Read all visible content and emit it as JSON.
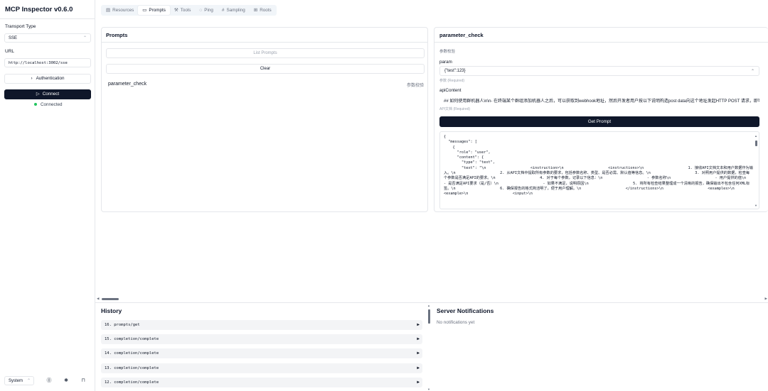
{
  "sidebar": {
    "title": "MCP Inspector v0.6.0",
    "transport_label": "Transport Type",
    "transport_value": "SSE",
    "url_label": "URL",
    "url_value": "http://localhost:3002/sse",
    "auth_label": "Authentication",
    "connect_label": "Connect",
    "status_text": "Connected",
    "theme_value": "System"
  },
  "tabs": [
    {
      "label": "Resources",
      "icon": "resources-icon"
    },
    {
      "label": "Prompts",
      "icon": "prompts-icon"
    },
    {
      "label": "Tools",
      "icon": "tools-icon"
    },
    {
      "label": "Ping",
      "icon": "ping-icon"
    },
    {
      "label": "Sampling",
      "icon": "sampling-icon"
    },
    {
      "label": "Roots",
      "icon": "roots-icon"
    }
  ],
  "prompts_panel": {
    "title": "Prompts",
    "list_button": "List Prompts",
    "clear_button": "Clear",
    "items": [
      {
        "name": "parameter_check",
        "description": "参数校验"
      }
    ]
  },
  "detail_panel": {
    "title": "parameter_check",
    "description": "参数校验",
    "param_label": "param",
    "param_value": "{\"test\":123}",
    "param_hint": "参数 (Required)",
    "api_label": "apiContent",
    "api_value": "## 如何使用群机器人\\n\\n- 在终端某个群组添加机器人之后，可以获取到webhook地址，然后开发者用户按以下说明构造post data向这个地址发起HTTP POST 请求，即可实",
    "api_hint": "API文档 (Required)",
    "get_button": "Get Prompt",
    "result_text": "{\n  \"messages\": [\n    {\n      \"role\": \"user\",\n      \"content\": {\n        \"type\": \"text\",\n        \"text\": \"\\n                    <instruction>\\n                    <instructions>\\n                    1. 接收API文档文本和用户数据作为输入。\\n                    2. 从API文档中提取所有参数的要求，包括参数名称、类型、是否必需、默认值等信息。\\n                    3. 对照用户提供的数据，检查每个参数是否满足API的要求。\\n                    4. 对于每个参数，记录以下信息：\\n                    - 参数名称\\n                    - 用户提供的值\\n                    - 是否满足API要求（是/否）\\n                    - 如果不满足，说明原因\\n                    5. 将所有检查结果整理成一个清晰的报告，确保输出不包含任何XML标签。\\n                    6. 确保报告的格式简洁明了，便于用户理解。\\n                    </instructions>\\n                    <examples>\\n                    <example>\\n                    <input>\\n"
  },
  "history": {
    "title": "History",
    "items": [
      "16. prompts/get",
      "15. completion/complete",
      "14. completion/complete",
      "13. completion/complete",
      "12. completion/complete"
    ]
  },
  "notifications": {
    "title": "Server Notifications",
    "empty_text": "No notifications yet"
  }
}
